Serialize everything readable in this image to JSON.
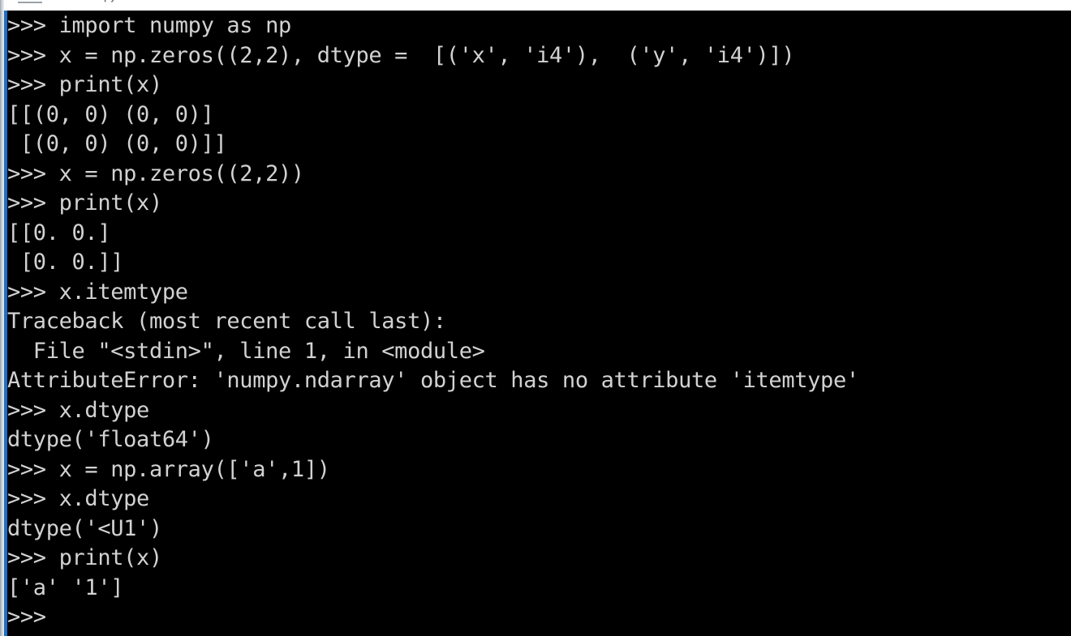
{
  "window": {
    "title_fragment": "py",
    "chrome_icon_name": "window-menu-icon",
    "active_border_color": "#1f6fc4",
    "background_color": "#000000",
    "text_color": "#d2d2d2"
  },
  "terminal": {
    "prompt": ">>>",
    "lines": [
      ">>> import numpy as np",
      ">>> x = np.zeros((2,2), dtype =  [('x', 'i4'),  ('y', 'i4')])",
      ">>> print(x)",
      "[[(0, 0) (0, 0)]",
      " [(0, 0) (0, 0)]]",
      ">>> x = np.zeros((2,2))",
      ">>> print(x)",
      "[[0. 0.]",
      " [0. 0.]]",
      ">>> x.itemtype",
      "Traceback (most recent call last):",
      "  File \"<stdin>\", line 1, in <module>",
      "AttributeError: 'numpy.ndarray' object has no attribute 'itemtype'",
      ">>> x.dtype",
      "dtype('float64')",
      ">>> x = np.array(['a',1])",
      ">>> x.dtype",
      "dtype('<U1')",
      ">>> print(x)",
      "['a' '1']",
      ">>> "
    ]
  }
}
